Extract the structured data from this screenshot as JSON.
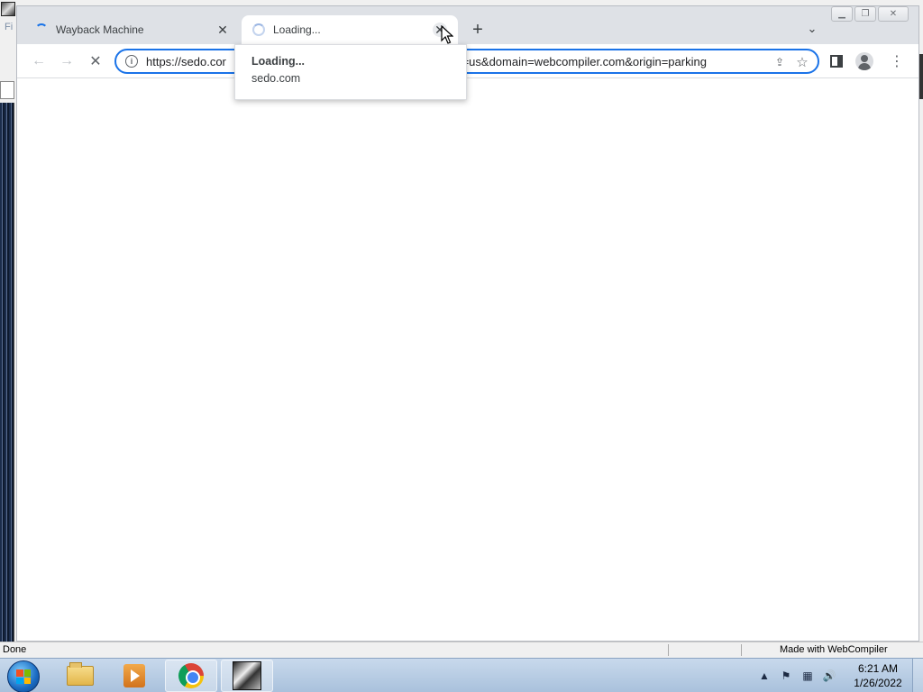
{
  "outer_app": {
    "menu_stub": "Fi",
    "status_left": "Done",
    "status_right": "Made with WebCompiler"
  },
  "browser": {
    "tabs": [
      {
        "title": "Wayback Machine",
        "state": "loading",
        "active": false
      },
      {
        "title": "Loading...",
        "state": "loading",
        "active": true
      }
    ],
    "omnibox": {
      "url_prefix": "https://sedo.cor",
      "url_suffix": "age=us&domain=webcompiler.com&origin=parking"
    },
    "hover_card": {
      "title": "Loading...",
      "domain": "sedo.com"
    },
    "icons": {
      "back": "arrow-left-icon",
      "forward": "arrow-right-icon",
      "stop": "stop-icon",
      "info": "info-icon",
      "share": "share-icon",
      "bookmark": "star-icon",
      "side_panel": "side-panel-icon",
      "profile": "profile-icon",
      "menu": "kebab-menu-icon",
      "new_tab": "plus-icon",
      "tab_search": "chevron-down-icon"
    },
    "accent_color": "#1a73e8"
  },
  "taskbar": {
    "apps": [
      "Windows Explorer",
      "Windows Media Player",
      "Google Chrome",
      "WebCompiler App"
    ],
    "clock_time": "6:21 AM",
    "clock_date": "1/26/2022"
  }
}
